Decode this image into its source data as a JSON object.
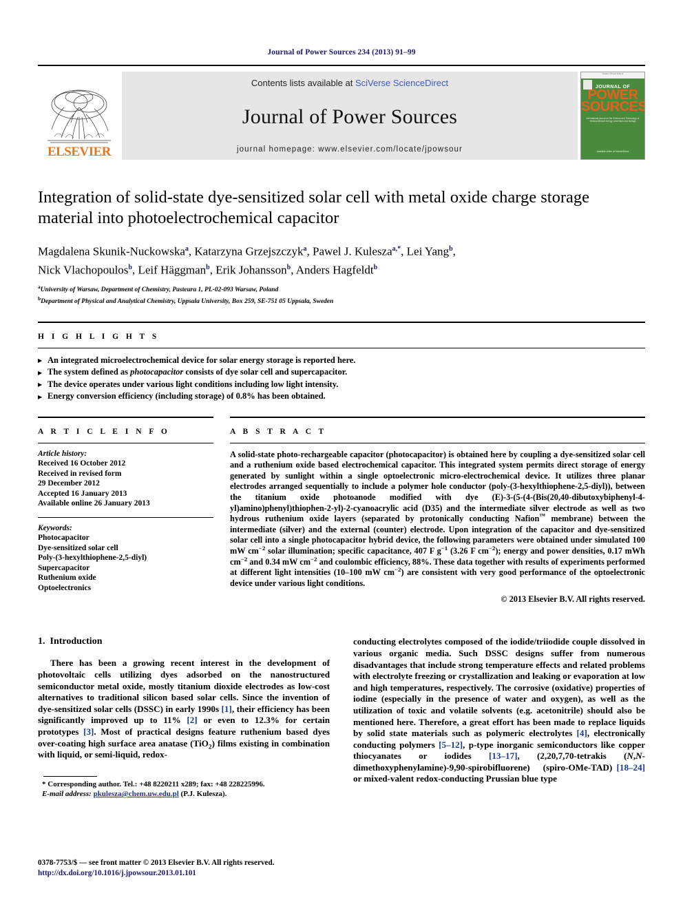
{
  "running_head": "Journal of Power Sources 234 (2013) 91–99",
  "masthead": {
    "publisher_logo_text": "ELSEVIER",
    "contents_prefix": "Contents lists available at ",
    "contents_link": "SciVerse ScienceDirect",
    "journal_title": "Journal of Power Sources",
    "homepage_line": "journal homepage: www.elsevier.com/locate/jpowsour",
    "cover": {
      "top_strip": "Journal of Power Sources",
      "kicker": "JOURNAL OF",
      "word1": "POWER",
      "word2": "SOURCES",
      "subtitle": "international journal on the Science and Technology of electrochemical energy conversion and storage",
      "bottom": "Available online at ScienceDirect"
    },
    "accent_orange": "#E87722",
    "cover_green": "#4a8a3c",
    "link_blue": "#3b5bbd"
  },
  "article": {
    "title": "Integration of solid-state dye-sensitized solar cell with metal oxide charge storage material into photoelectrochemical capacitor",
    "authors_line1": "Magdalena Skunik-Nuckowska a, Katarzyna Grzejszczyk a, Pawel J. Kulesza a,*, Lei Yang b,",
    "authors_line2": "Nick Vlachopoulos b, Leif Häggman b, Erik Johansson b, Anders Hagfeldt b",
    "affiliations": [
      {
        "mark": "a",
        "text": "University of Warsaw, Department of Chemistry, Pasteura 1, PL-02-093 Warsaw, Poland"
      },
      {
        "mark": "b",
        "text": "Department of Physical and Analytical Chemistry, Uppsala University, Box 259, SE-751 05 Uppsala, Sweden"
      }
    ]
  },
  "highlights": {
    "label": "H I G H L I G H T S",
    "items": [
      "An integrated microelectrochemical device for solar energy storage is reported here.",
      "The system defined as photocapacitor consists of dye solar cell and supercapacitor.",
      "The device operates under various light conditions including low light intensity.",
      "Energy conversion efficiency (including storage) of 0.8% has been obtained."
    ],
    "italic_term": "photocapacitor",
    "bullet_icon": "triangle-right-icon"
  },
  "article_info": {
    "label": "A R T I C L E   I N F O",
    "history_heading": "Article history:",
    "history": [
      "Received 16 October 2012",
      "Received in revised form",
      "29 December 2012",
      "Accepted 16 January 2013",
      "Available online 26 January 2013"
    ],
    "keywords_heading": "Keywords:",
    "keywords": [
      "Photocapacitor",
      "Dye-sensitized solar cell",
      "Poly-(3-hexylthiophene-2,5-diyl)",
      "Supercapacitor",
      "Ruthenium oxide",
      "Optoelectronics"
    ]
  },
  "abstract": {
    "label": "A B S T R A C T",
    "text": "A solid-state photo-rechargeable capacitor (photocapacitor) is obtained here by coupling a dye-sensitized solar cell and a ruthenium oxide based electrochemical capacitor. This integrated system permits direct storage of energy generated by sunlight within a single optoelectronic micro-electrochemical device. It utilizes three planar electrodes arranged sequentially to include a polymer hole conductor (poly-(3-hexylthiophene-2,5-diyl)), between the titanium oxide photoanode modified with dye (E)-3-(5-(4-(Bis(20,40-dibutoxybiphenyl-4-yl)amino)phenyl)thiophen-2-yl)-2-cyanoacrylic acid (D35) and the intermediate silver electrode as well as two hydrous ruthenium oxide layers (separated by protonically conducting Nafion™ membrane) between the intermediate (silver) and the external (counter) electrode. Upon integration of the capacitor and dye-sensitized solar cell into a single photocapacitor hybrid device, the following parameters were obtained under simulated 100 mW cm−2 solar illumination; specific capacitance, 407 F g−1 (3.26 F cm−2); energy and power densities, 0.17 mWh cm−2 and 0.34 mW cm−2 and coulombic efficiency, 88%. These data together with results of experiments performed at different light intensities (10–100 mW cm−2) are consistent with very good performance of the optoelectronic device under various light conditions.",
    "copyright": "© 2013 Elsevier B.V. All rights reserved."
  },
  "introduction": {
    "number": "1.",
    "heading": "Introduction",
    "left_paragraph": "There has been a growing recent interest in the development of photovoltaic cells utilizing dyes adsorbed on the nanostructured semiconductor metal oxide, mostly titanium dioxide electrodes as low-cost alternatives to traditional silicon based solar cells. Since the invention of dye-sensitized solar cells (DSSC) in early 1990s [1], their efficiency has been significantly improved up to 11% [2] or even to 12.3% for certain prototypes [3]. Most of practical designs feature ruthenium based dyes over-coating high surface area anatase (TiO2) films existing in combination with liquid, or semi-liquid, redox-",
    "right_paragraph": "conducting electrolytes composed of the iodide/triiodide couple dissolved in various organic media. Such DSSC designs suffer from numerous disadvantages that include strong temperature effects and related problems with electrolyte freezing or crystallization and leaking or evaporation at low and high temperatures, respectively. The corrosive (oxidative) properties of iodine (especially in the presence of water and oxygen), as well as the utilization of toxic and volatile solvents (e.g. acetonitrile) should also be mentioned here. Therefore, a great effort has been made to replace liquids by solid state materials such as polymeric electrolytes [4], electronically conducting polymers [5–12], p-type inorganic semiconductors like copper thiocyanates or iodides [13–17], (2,20,7,70-tetrakis (N,N-dimethoxyphenylamine)-9,90-spirobifluorene) (spiro-OMe-TAD) [18–24] or mixed-valent redox-conducting Prussian blue type"
  },
  "footnote": {
    "line1": "* Corresponding author. Tel.: +48 8220211 x289; fax: +48 228225996.",
    "line2_label": "E-mail address:",
    "email": "pkulesza@chem.uw.edu.pl",
    "line2_suffix": "(P.J. Kulesza)."
  },
  "page_footer": {
    "issn_line": "0378-7753/$ — see front matter © 2013 Elsevier B.V. All rights reserved.",
    "doi_line": "http://dx.doi.org/10.1016/j.jpowsour.2013.01.101"
  }
}
